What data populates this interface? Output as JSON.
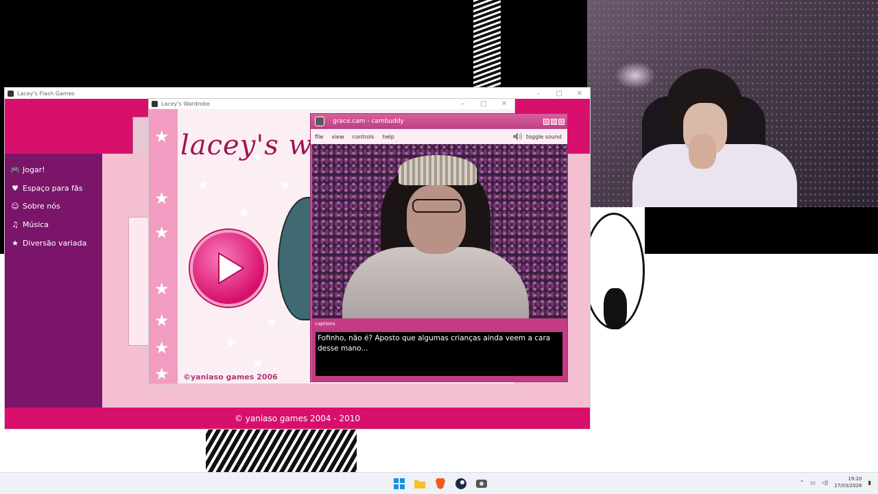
{
  "main_window": {
    "title": "Lacey's Flash Games",
    "nav": [
      {
        "label": "Jogar!",
        "icon": "gamepad-icon"
      },
      {
        "label": "Espaço para fãs",
        "icon": "fans-icon"
      },
      {
        "label": "Sobre nós",
        "icon": "smiley-icon"
      },
      {
        "label": "Música",
        "icon": "music-icon"
      },
      {
        "label": "Diversão variada",
        "icon": "star-icon"
      }
    ],
    "footer": "© yaniaso games 2004 - 2010"
  },
  "wardrobe_window": {
    "title": "Lacey's Wardrobe",
    "heading": "lacey's wardrobe",
    "copyright": "©yaniaso games 2006"
  },
  "cam_window": {
    "title": "grace.cam - cambuddy",
    "menu": [
      "file",
      "view",
      "controls",
      "help"
    ],
    "toggle_sound": "toggle sound",
    "captions_label": "captions",
    "caption_text": "Fofinho, não é? Aposto que algumas crianças ainda veem a cara desse mano..."
  },
  "taskbar": {
    "apps": [
      "windows-start-icon",
      "file-explorer-icon",
      "brave-browser-icon",
      "steam-icon",
      "cambuddy-app-icon"
    ],
    "time": "19:20",
    "date": "27/03/2026"
  },
  "colors": {
    "brand_pink": "#d8106c",
    "sidebar_purple": "#7a1569",
    "light_pink": "#f4bfd2"
  }
}
